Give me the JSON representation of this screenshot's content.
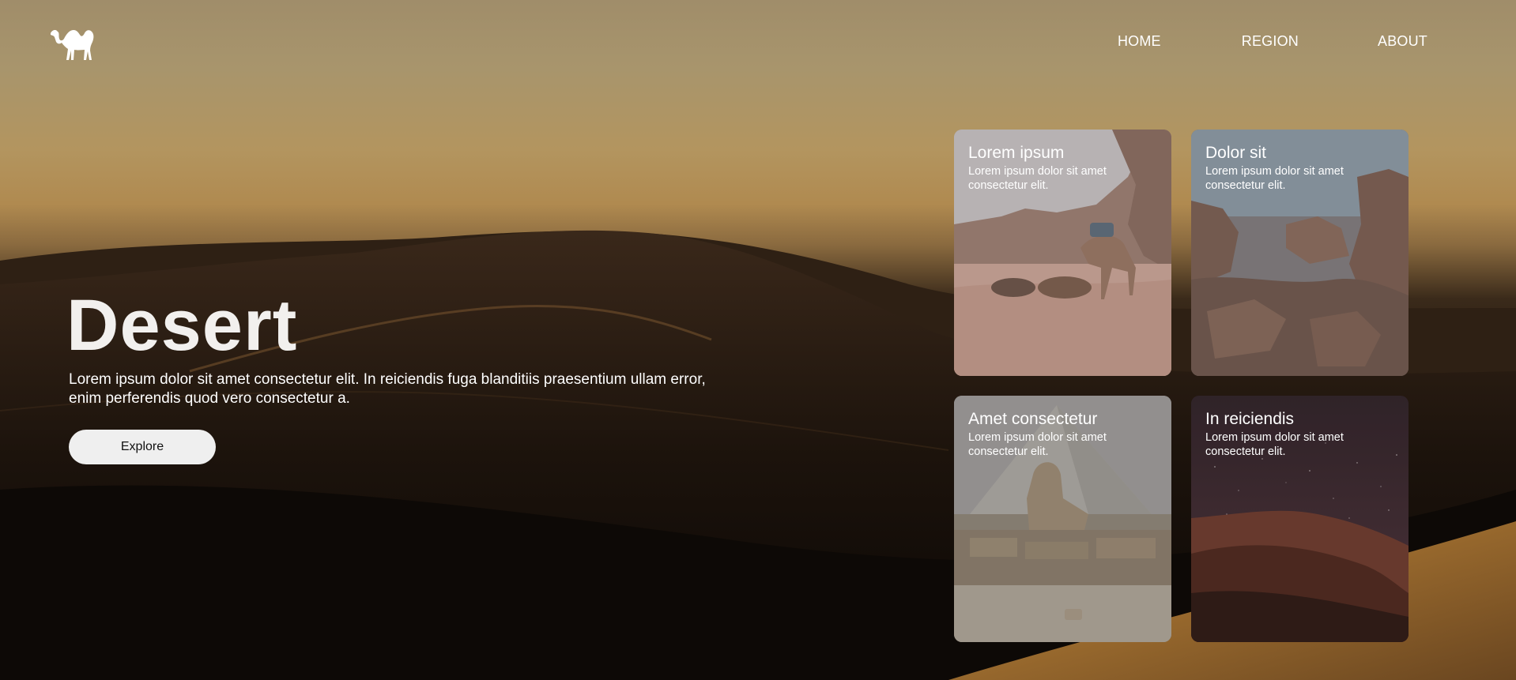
{
  "header": {
    "logo_icon": "camel-icon",
    "nav": [
      {
        "label": "HOME"
      },
      {
        "label": "REGION"
      },
      {
        "label": "ABOUT"
      }
    ]
  },
  "hero": {
    "title": "Desert",
    "description": "Lorem ipsum dolor sit amet consectetur elit. In reiciendis fuga blanditiis praesentium ullam error, enim perferendis quod vero consectetur a.",
    "button_label": "Explore"
  },
  "cards": [
    {
      "title": "Lorem ipsum",
      "text": "Lorem ipsum dolor sit amet consectetur elit.",
      "image": "camels-in-desert"
    },
    {
      "title": "Dolor sit",
      "text": "Lorem ipsum dolor sit amet consectetur elit.",
      "image": "rocky-canyon"
    },
    {
      "title": "Amet consectetur",
      "text": "Lorem ipsum dolor sit amet consectetur elit.",
      "image": "sphinx-and-pyramid"
    },
    {
      "title": "In reiciendis",
      "text": "Lorem ipsum dolor sit amet consectetur elit.",
      "image": "starry-night-dunes"
    }
  ],
  "colors": {
    "text": "#ffffff",
    "button_bg": "#efefef",
    "sky_top": "#a08d6a",
    "sand": "#b07a30"
  }
}
